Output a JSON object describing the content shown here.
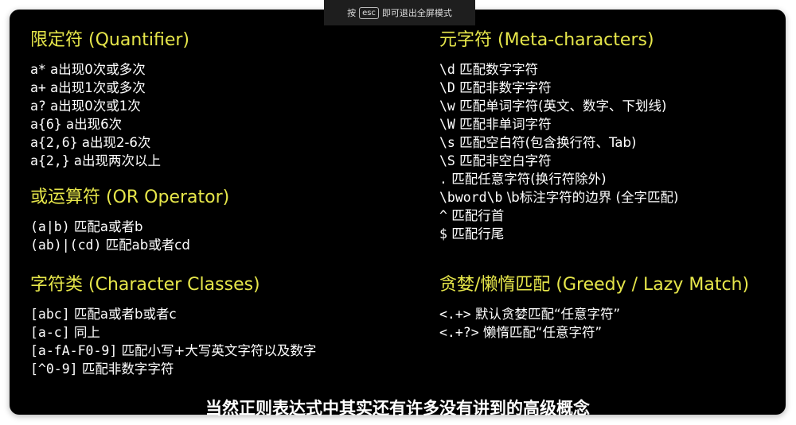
{
  "toast": {
    "prefix": "按",
    "key": "esc",
    "suffix": "即可退出全屏模式"
  },
  "sections": {
    "quantifier": {
      "title": "限定符 (Quantifier)",
      "lines": [
        [
          "a*",
          "a出现0次或多次"
        ],
        [
          "a+",
          "a出现1次或多次"
        ],
        [
          "a?",
          "a出现0次或1次"
        ],
        [
          "a{6}",
          "a出现6次"
        ],
        [
          "a{2,6}",
          "a出现2-6次"
        ],
        [
          "a{2,}",
          "a出现两次以上"
        ]
      ]
    },
    "or": {
      "title": "或运算符 (OR Operator)",
      "lines": [
        [
          "(a|b)",
          "匹配a或者b"
        ],
        [
          "(ab)|(cd)",
          "匹配ab或者cd"
        ]
      ]
    },
    "classes": {
      "title": "字符类 (Character Classes)",
      "lines": [
        [
          "[abc]",
          "匹配a或者b或者c"
        ],
        [
          "[a-c]",
          "同上"
        ],
        [
          "[a-fA-F0-9]",
          "匹配小写+大写英文字符以及数字"
        ],
        [
          "[^0-9]",
          "匹配非数字字符"
        ]
      ]
    },
    "meta": {
      "title": "元字符 (Meta-characters)",
      "lines": [
        [
          "\\d",
          "匹配数字字符"
        ],
        [
          "\\D",
          "匹配非数字字符"
        ],
        [
          "\\w",
          "匹配单词字符(英文、数字、下划线)"
        ],
        [
          "\\W",
          "匹配非单词字符"
        ],
        [
          "\\s",
          "匹配空白符(包含换行符、Tab)"
        ],
        [
          "\\S",
          "匹配非空白字符"
        ],
        [
          ".",
          "匹配任意字符(换行符除外)"
        ],
        [
          "\\bword\\b",
          "\\b标注字符的边界 (全字匹配)"
        ],
        [
          "^",
          "匹配行首"
        ],
        [
          "$",
          "匹配行尾"
        ]
      ]
    },
    "greedy": {
      "title": "贪婪/懒惰匹配 (Greedy / Lazy Match)",
      "lines": [
        [
          "<.+>",
          "默认贪婪匹配“任意字符”"
        ],
        [
          "<.+?>",
          "懒惰匹配“任意字符”"
        ]
      ]
    }
  },
  "caption": "当然正则表达式中其实还有许多没有讲到的高级概念"
}
